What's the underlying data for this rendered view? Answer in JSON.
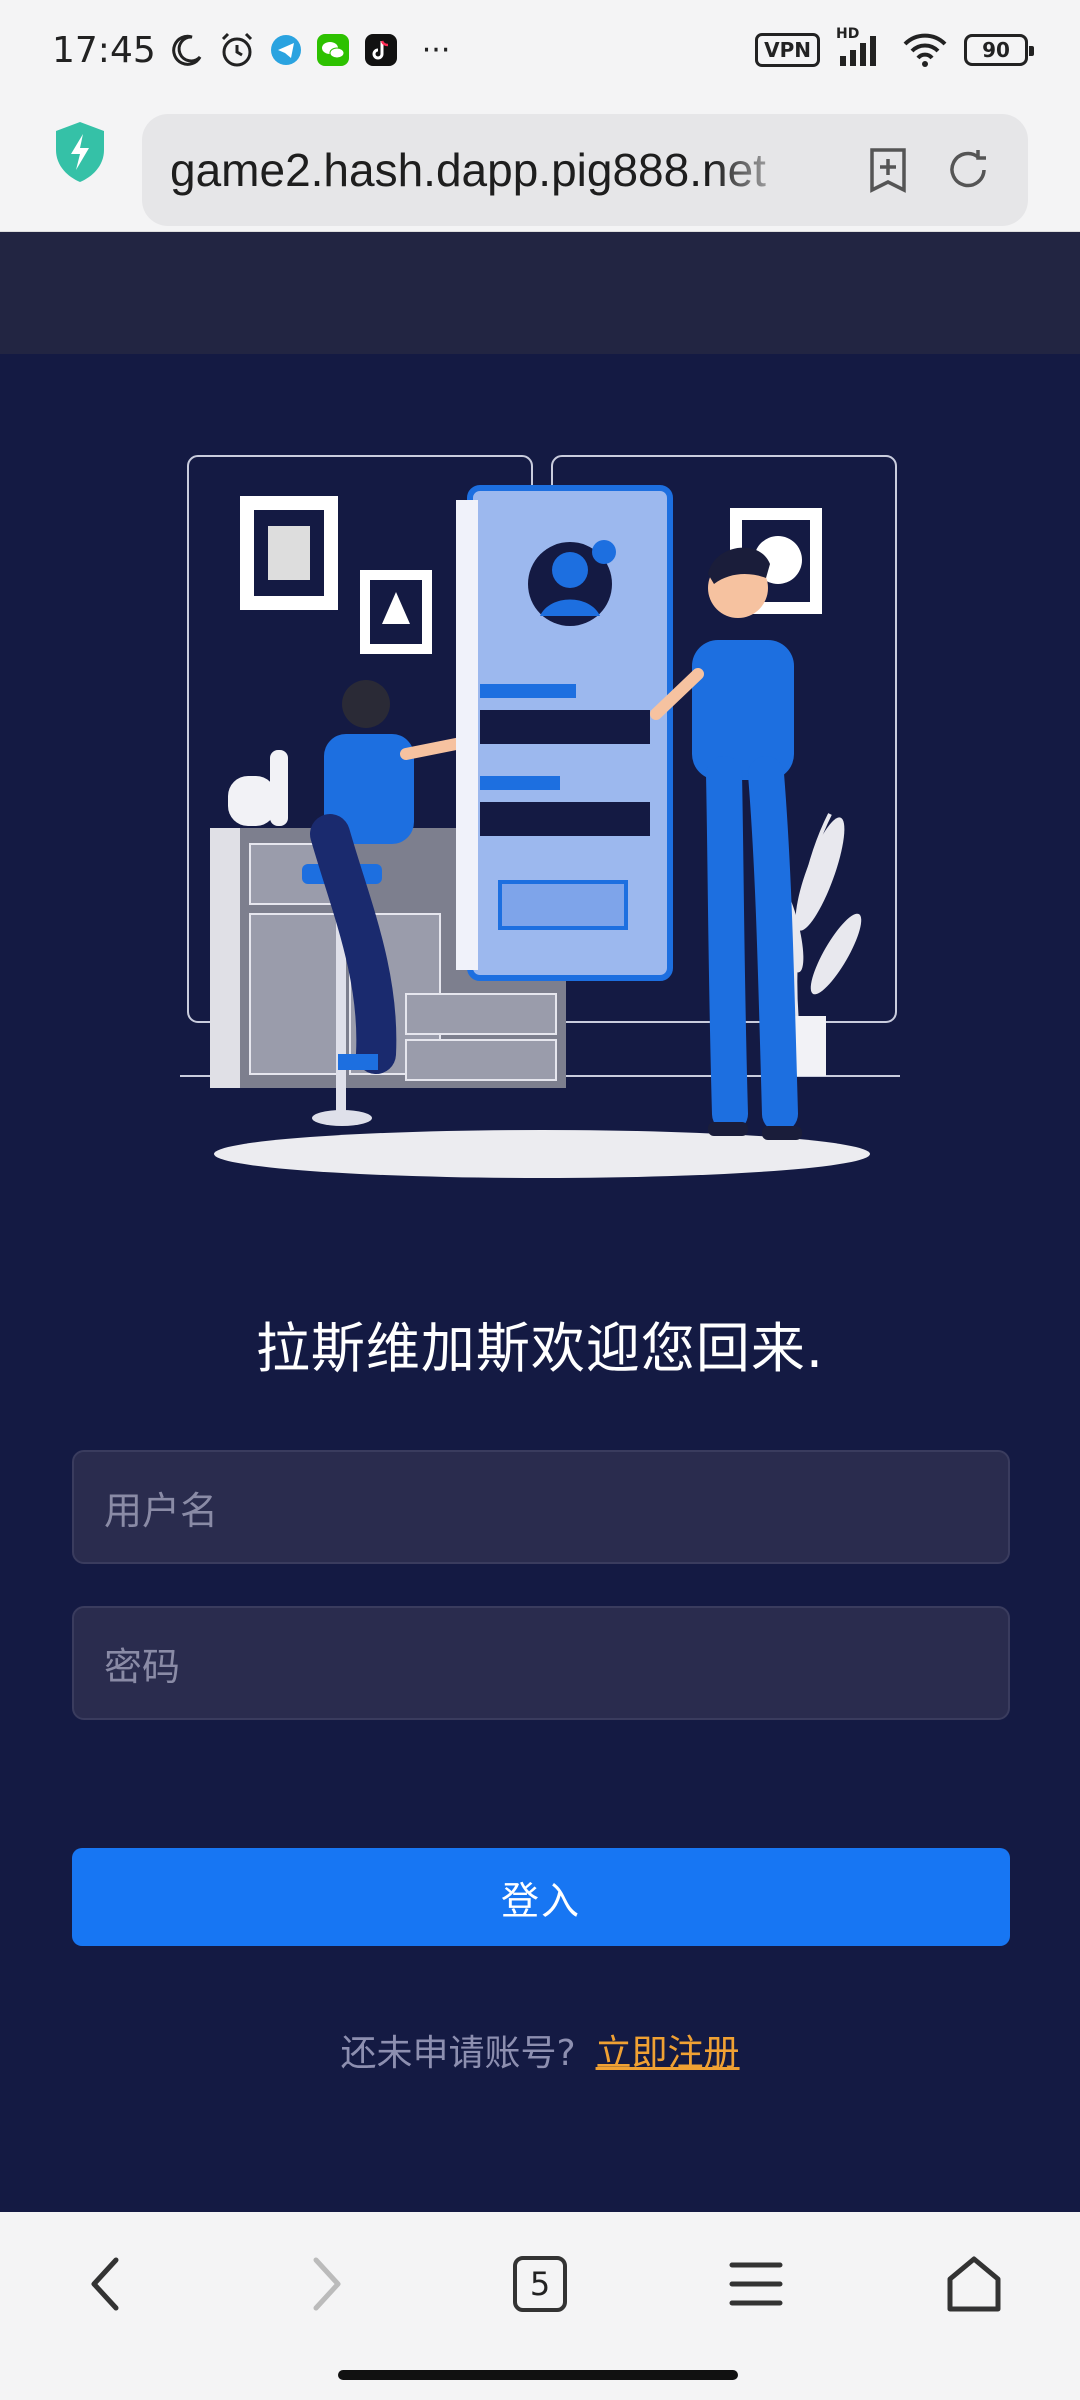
{
  "status_bar": {
    "time": "17:45",
    "icons_left": [
      "moon-icon",
      "alarm-icon",
      "telegram-icon",
      "wechat-icon",
      "tiktok-icon",
      "more-icon"
    ],
    "more": "···",
    "vpn": "VPN",
    "signal_label": "HD",
    "battery": "90"
  },
  "browser": {
    "url": "game2.hash.dapp.pig888.net",
    "security_icon": "shield-bolt-icon",
    "bookmark_icon": "bookmark-add-icon",
    "refresh_icon": "refresh-icon"
  },
  "login": {
    "welcome": "拉斯维加斯欢迎您回来.",
    "username_placeholder": "用户名",
    "password_placeholder": "密码",
    "login_button": "登入",
    "no_account_text": "还未申请账号?",
    "register_link": "立即注册"
  },
  "bottom_nav": {
    "back_icon": "chevron-left-icon",
    "forward_icon": "chevron-right-icon",
    "tab_count": "5",
    "menu_icon": "hamburger-icon",
    "home_icon": "home-icon"
  },
  "colors": {
    "page_bg": "#141a43",
    "header_bg": "#222542",
    "primary": "#1776f3",
    "link": "#f0a133",
    "field_bg": "#2a2c4e"
  }
}
